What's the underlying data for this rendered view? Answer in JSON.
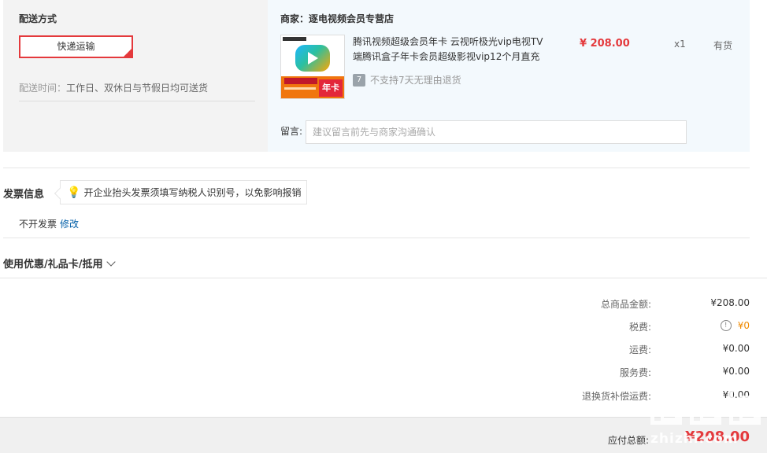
{
  "shipping": {
    "section_title": "配送方式",
    "option_label": "快递运输",
    "time_label": "配送时间：",
    "time_value": "工作日、双休日与节假日均可送货"
  },
  "store": {
    "name_label": "商家：逐电视频会员专营店",
    "product": {
      "title": "腾讯视频超级会员年卡 云视听极光vip电视TV端腾讯盒子年卡会员超级影视vip12个月直充",
      "return_icon": "7",
      "return_policy": "不支持7天无理由退货",
      "price": "¥ 208.00",
      "quantity": "x1",
      "stock": "有货",
      "thumb_badge": "年卡"
    },
    "message_label": "留言:",
    "message_placeholder": "建议留言前先与商家沟通确认"
  },
  "invoice": {
    "title": "发票信息",
    "tip": "开企业抬头发票须填写纳税人识别号，以免影响报销",
    "status": "不开发票",
    "modify_link": "修改"
  },
  "coupon": {
    "label": "使用优惠/礼品卡/抵用"
  },
  "summary": {
    "goods_label": "总商品金额:",
    "goods_value": "¥208.00",
    "tax_label": "税费:",
    "tax_value": "¥0",
    "shipping_label": "运费:",
    "shipping_value": "¥0.00",
    "service_label": "服务费:",
    "service_value": "¥0.00",
    "return_ship_label": "退换货补偿运费:",
    "return_ship_value": "¥0.00",
    "total_label": "应付总额:",
    "total_value": "¥208.00"
  },
  "watermark": {
    "text": "zhizhi.com"
  },
  "colors": {
    "accent": "#e4393c",
    "link": "#005ea7",
    "tax": "#f08a00",
    "ship_panel_bg": "#f3f3f3",
    "store_panel_bg": "#f3f9fd"
  },
  "icons": {
    "tip": "lightbulb-icon",
    "return": "return-policy-icon",
    "tax_info": "info-circle-icon",
    "coupon_expand": "chevron-down-icon",
    "selected": "checkmark-icon"
  }
}
